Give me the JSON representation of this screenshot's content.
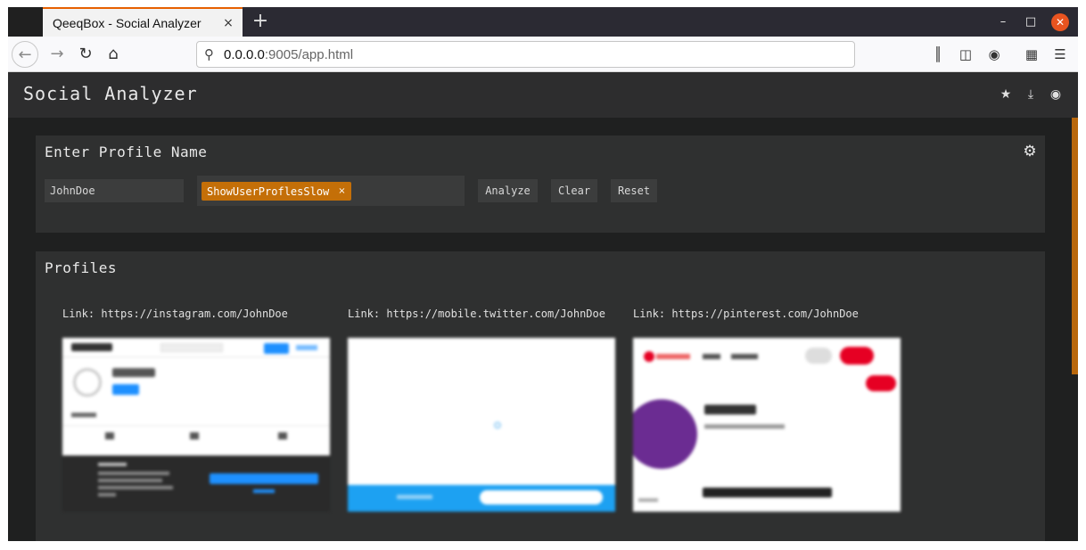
{
  "browser": {
    "tab_title": "QeeqBox - Social Analyzer",
    "tab_close": "×",
    "new_tab": "+",
    "url_host": "0.0.0.0",
    "url_rest": ":9005/app.html",
    "window_minimize": "–",
    "window_maximize": "□",
    "window_close": "✕"
  },
  "app": {
    "title": "Social Analyzer"
  },
  "search_panel": {
    "title": "Enter Profile Name",
    "profile_input_value": "JohnDoe",
    "option_tag": "ShowUserProflesSlow",
    "option_tag_remove": "×",
    "analyze_label": "Analyze",
    "clear_label": "Clear",
    "reset_label": "Reset"
  },
  "profiles_panel": {
    "title": "Profiles",
    "cards": [
      {
        "link": "Link: https://instagram.com/JohnDoe"
      },
      {
        "link": "Link: https://mobile.twitter.com/JohnDoe"
      },
      {
        "link": "Link: https://pinterest.com/JohnDoe"
      }
    ]
  },
  "colors": {
    "accent": "#c46f08",
    "scrollbar": "#b8670c",
    "panel_bg": "#2f3030",
    "app_bg": "#1f2020"
  }
}
